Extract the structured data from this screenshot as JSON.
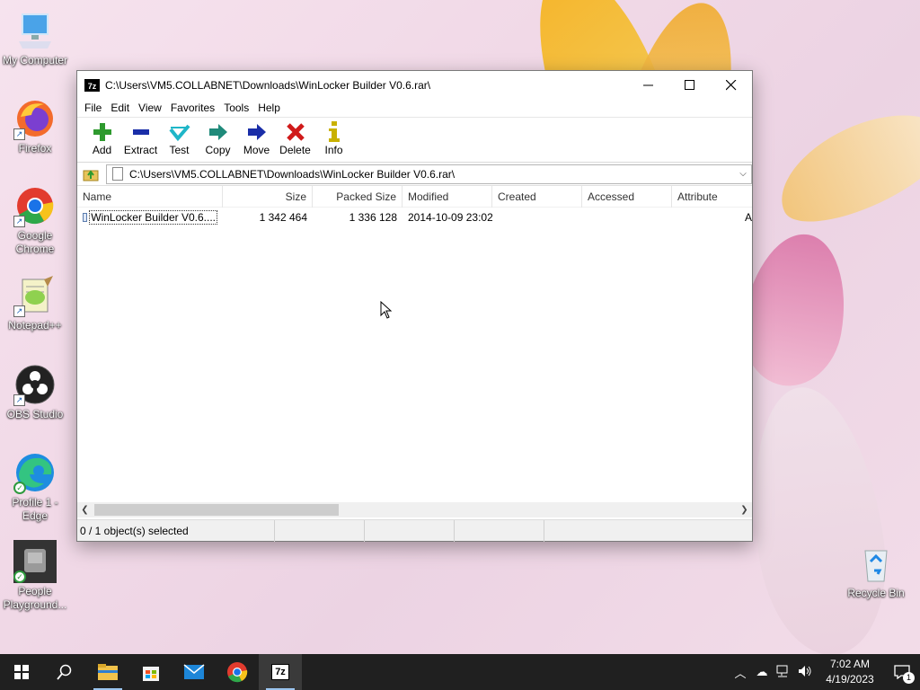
{
  "desktop": {
    "icons": [
      {
        "label": "My Computer"
      },
      {
        "label": "Firefox"
      },
      {
        "label": "Google Chrome"
      },
      {
        "label": "Notepad++"
      },
      {
        "label": "OBS Studio"
      },
      {
        "label": "Profile 1 - Edge"
      },
      {
        "label": "People Playground..."
      },
      {
        "label": "Recycle Bin"
      }
    ]
  },
  "window": {
    "title": "C:\\Users\\VM5.COLLABNET\\Downloads\\WinLocker Builder V0.6.rar\\",
    "app_icon_text": "7z",
    "menu": [
      "File",
      "Edit",
      "View",
      "Favorites",
      "Tools",
      "Help"
    ],
    "toolbar": [
      {
        "label": "Add",
        "icon": "plus-icon",
        "color": "#2e9a2e"
      },
      {
        "label": "Extract",
        "icon": "minus-icon",
        "color": "#1a2ea8"
      },
      {
        "label": "Test",
        "icon": "check-icon",
        "color": "#1fb6c8"
      },
      {
        "label": "Copy",
        "icon": "arrow-right-icon",
        "color": "#1f8a7a"
      },
      {
        "label": "Move",
        "icon": "arrow-right-icon",
        "color": "#1a2ea8"
      },
      {
        "label": "Delete",
        "icon": "x-icon",
        "color": "#d01a1a"
      },
      {
        "label": "Info",
        "icon": "info-icon",
        "color": "#c9b100"
      }
    ],
    "address": "C:\\Users\\VM5.COLLABNET\\Downloads\\WinLocker Builder V0.6.rar\\",
    "columns": [
      "Name",
      "Size",
      "Packed Size",
      "Modified",
      "Created",
      "Accessed",
      "Attribute"
    ],
    "rows": [
      {
        "name": "WinLocker Builder V0.6....",
        "size": "1 342 464",
        "packed": "1 336 128",
        "modified": "2014-10-09 23:02",
        "created": "",
        "accessed": "",
        "attr": "A"
      }
    ],
    "status": "0 / 1 object(s) selected"
  },
  "taskbar": {
    "time": "7:02 AM",
    "date": "4/19/2023",
    "notification_count": "1",
    "active_app_label": "7z"
  }
}
